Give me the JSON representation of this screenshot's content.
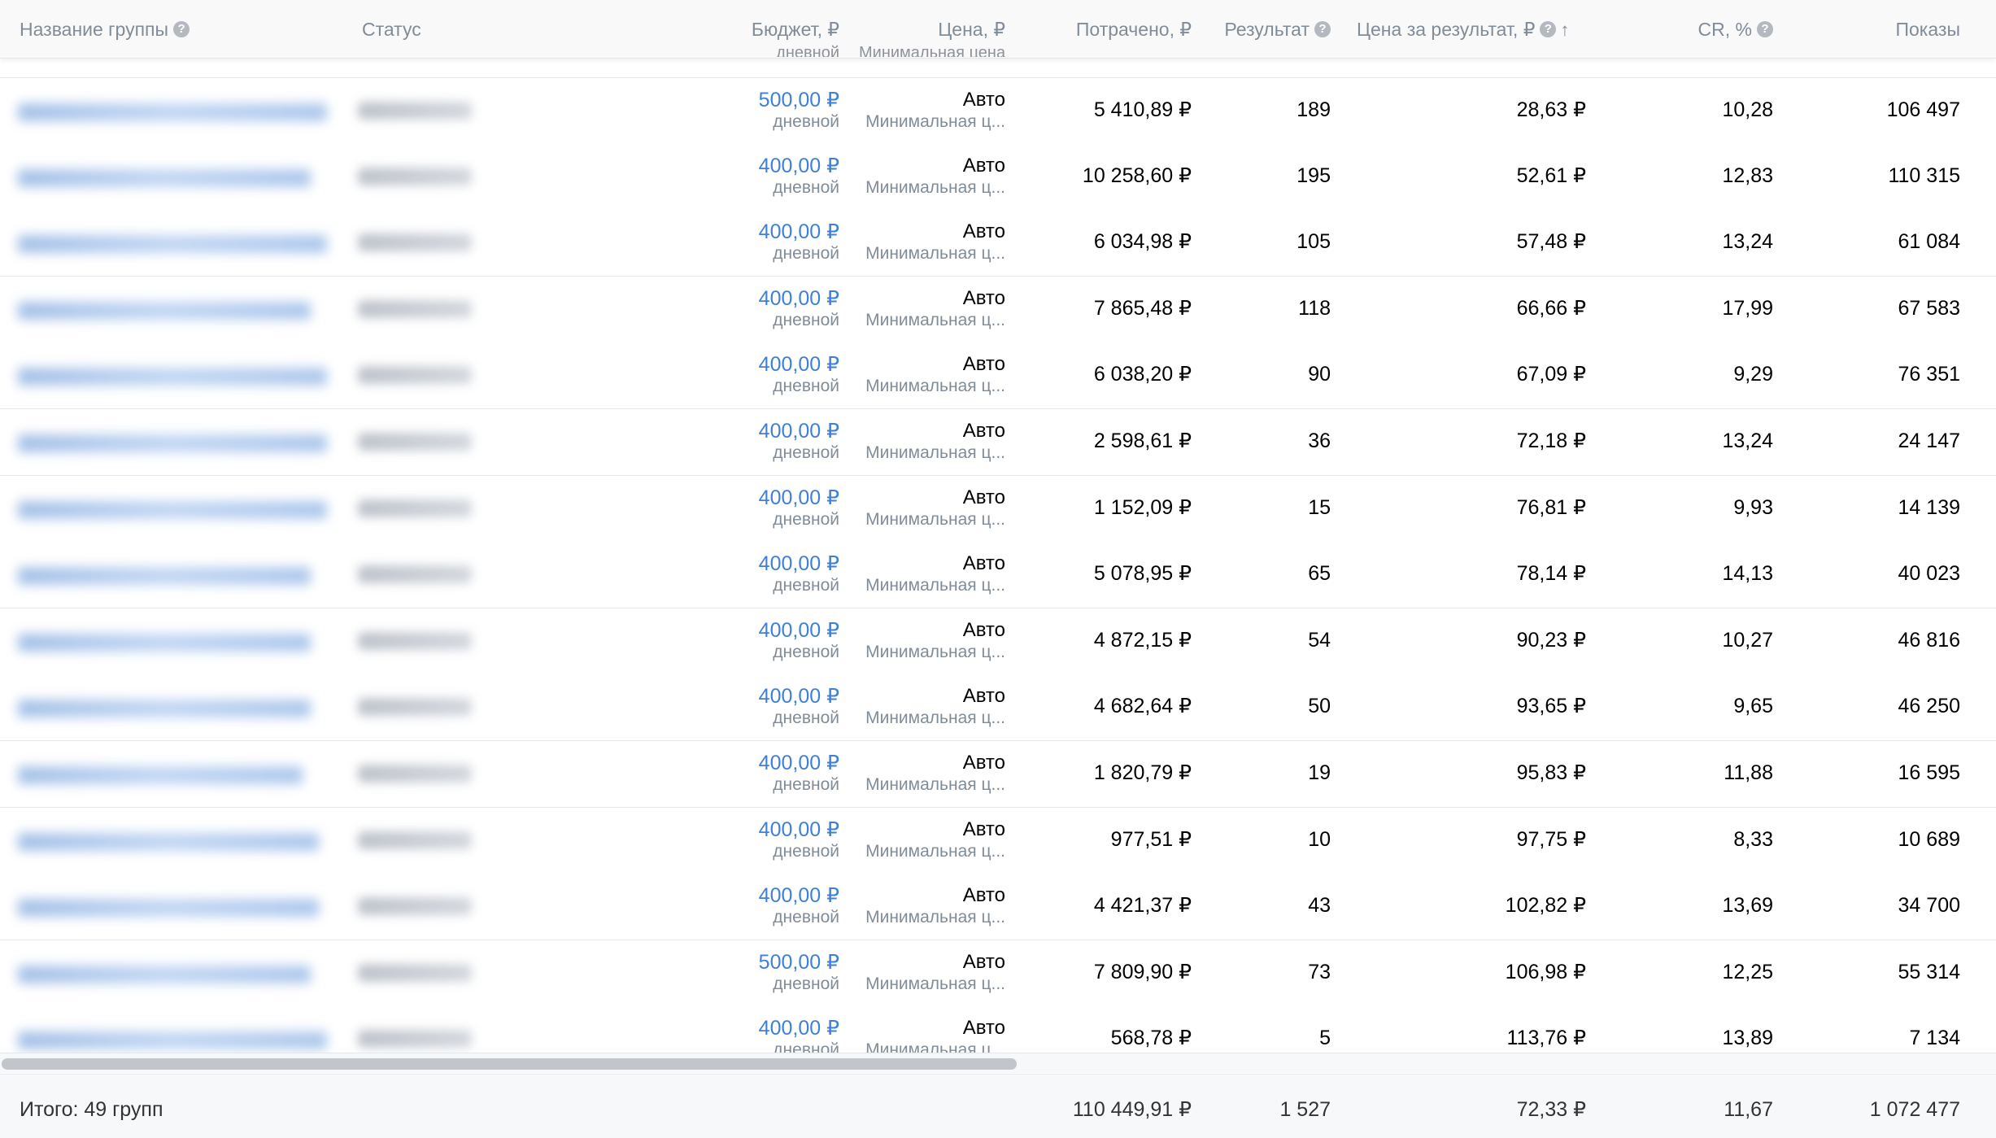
{
  "header": {
    "columns": {
      "name": "Название группы",
      "status": "Статус",
      "budget": "Бюджет, ₽",
      "price": "Цена, ₽",
      "spent": "Потрачено, ₽",
      "result": "Результат",
      "price_per_result": "Цена за результат, ₽",
      "cr": "CR, %",
      "shows": "Показы"
    },
    "help_icon": "?",
    "sort_icon": "↑",
    "peek_budget": "дневной",
    "peek_price": "Минимальная цена"
  },
  "rows": [
    {
      "budget": "500,00 ₽",
      "budget_period": "дневной",
      "price": "Авто",
      "price_sub": "Минимальная ц...",
      "spent": "5 410,89 ₽",
      "result": "189",
      "price_per_result": "28,63 ₽",
      "cr": "10,28",
      "shows": "106 497"
    },
    {
      "budget": "400,00 ₽",
      "budget_period": "дневной",
      "price": "Авто",
      "price_sub": "Минимальная ц...",
      "spent": "10 258,60 ₽",
      "result": "195",
      "price_per_result": "52,61 ₽",
      "cr": "12,83",
      "shows": "110 315"
    },
    {
      "budget": "400,00 ₽",
      "budget_period": "дневной",
      "price": "Авто",
      "price_sub": "Минимальная ц...",
      "spent": "6 034,98 ₽",
      "result": "105",
      "price_per_result": "57,48 ₽",
      "cr": "13,24",
      "shows": "61 084"
    },
    {
      "budget": "400,00 ₽",
      "budget_period": "дневной",
      "price": "Авто",
      "price_sub": "Минимальная ц...",
      "spent": "7 865,48 ₽",
      "result": "118",
      "price_per_result": "66,66 ₽",
      "cr": "17,99",
      "shows": "67 583"
    },
    {
      "budget": "400,00 ₽",
      "budget_period": "дневной",
      "price": "Авто",
      "price_sub": "Минимальная ц...",
      "spent": "6 038,20 ₽",
      "result": "90",
      "price_per_result": "67,09 ₽",
      "cr": "9,29",
      "shows": "76 351"
    },
    {
      "budget": "400,00 ₽",
      "budget_period": "дневной",
      "price": "Авто",
      "price_sub": "Минимальная ц...",
      "spent": "2 598,61 ₽",
      "result": "36",
      "price_per_result": "72,18 ₽",
      "cr": "13,24",
      "shows": "24 147"
    },
    {
      "budget": "400,00 ₽",
      "budget_period": "дневной",
      "price": "Авто",
      "price_sub": "Минимальная ц...",
      "spent": "1 152,09 ₽",
      "result": "15",
      "price_per_result": "76,81 ₽",
      "cr": "9,93",
      "shows": "14 139"
    },
    {
      "budget": "400,00 ₽",
      "budget_period": "дневной",
      "price": "Авто",
      "price_sub": "Минимальная ц...",
      "spent": "5 078,95 ₽",
      "result": "65",
      "price_per_result": "78,14 ₽",
      "cr": "14,13",
      "shows": "40 023"
    },
    {
      "budget": "400,00 ₽",
      "budget_period": "дневной",
      "price": "Авто",
      "price_sub": "Минимальная ц...",
      "spent": "4 872,15 ₽",
      "result": "54",
      "price_per_result": "90,23 ₽",
      "cr": "10,27",
      "shows": "46 816"
    },
    {
      "budget": "400,00 ₽",
      "budget_period": "дневной",
      "price": "Авто",
      "price_sub": "Минимальная ц...",
      "spent": "4 682,64 ₽",
      "result": "50",
      "price_per_result": "93,65 ₽",
      "cr": "9,65",
      "shows": "46 250"
    },
    {
      "budget": "400,00 ₽",
      "budget_period": "дневной",
      "price": "Авто",
      "price_sub": "Минимальная ц...",
      "spent": "1 820,79 ₽",
      "result": "19",
      "price_per_result": "95,83 ₽",
      "cr": "11,88",
      "shows": "16 595"
    },
    {
      "budget": "400,00 ₽",
      "budget_period": "дневной",
      "price": "Авто",
      "price_sub": "Минимальная ц...",
      "spent": "977,51 ₽",
      "result": "10",
      "price_per_result": "97,75 ₽",
      "cr": "8,33",
      "shows": "10 689"
    },
    {
      "budget": "400,00 ₽",
      "budget_period": "дневной",
      "price": "Авто",
      "price_sub": "Минимальная ц...",
      "spent": "4 421,37 ₽",
      "result": "43",
      "price_per_result": "102,82 ₽",
      "cr": "13,69",
      "shows": "34 700"
    },
    {
      "budget": "500,00 ₽",
      "budget_period": "дневной",
      "price": "Авто",
      "price_sub": "Минимальная ц...",
      "spent": "7 809,90 ₽",
      "result": "73",
      "price_per_result": "106,98 ₽",
      "cr": "12,25",
      "shows": "55 314"
    },
    {
      "budget": "400,00 ₽",
      "budget_period": "дневной",
      "price": "Авто",
      "price_sub": "Минимальная ц...",
      "spent": "568,78 ₽",
      "result": "5",
      "price_per_result": "113,76 ₽",
      "cr": "13,89",
      "shows": "7 134"
    }
  ],
  "footer": {
    "total_label": "Итого: 49 групп",
    "spent": "110 449,91 ₽",
    "result": "1 527",
    "price_per_result": "72,33 ₽",
    "cr": "11,67",
    "shows": "1 072 477"
  },
  "colors": {
    "link": "#3e80d8",
    "header_text": "#818c99",
    "secondary_text": "#818c99",
    "divider": "#e7e8ec",
    "scroll_thumb": "#c2c5ca"
  }
}
